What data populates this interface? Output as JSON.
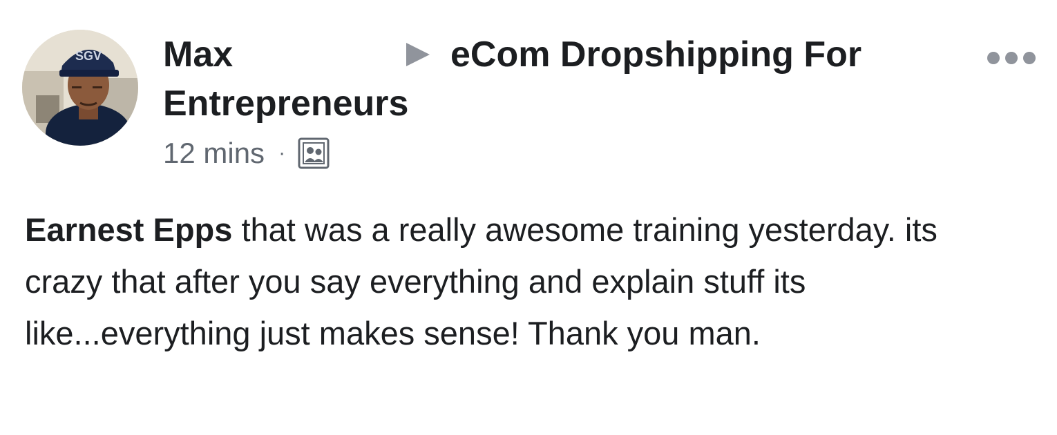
{
  "post": {
    "author": "Max",
    "group_name_line1": "eCom Dropshipping For",
    "group_name_line2": "Entrepreneurs",
    "timestamp": "12 mins",
    "separator": "·",
    "audience_icon": "group-icon",
    "more_icon": "more-horizontal-icon",
    "arrow_icon": "triangle-right-icon",
    "avatar_cap_text": "SGV",
    "body": {
      "mention": "Earnest Epps",
      "text": " that was a really awesome training yesterday. its crazy that after you say everything and explain stuff its like...everything just makes sense! Thank you man."
    }
  },
  "colors": {
    "text_primary": "#1c1e21",
    "text_secondary": "#606770",
    "icon_gray": "#90949c"
  }
}
